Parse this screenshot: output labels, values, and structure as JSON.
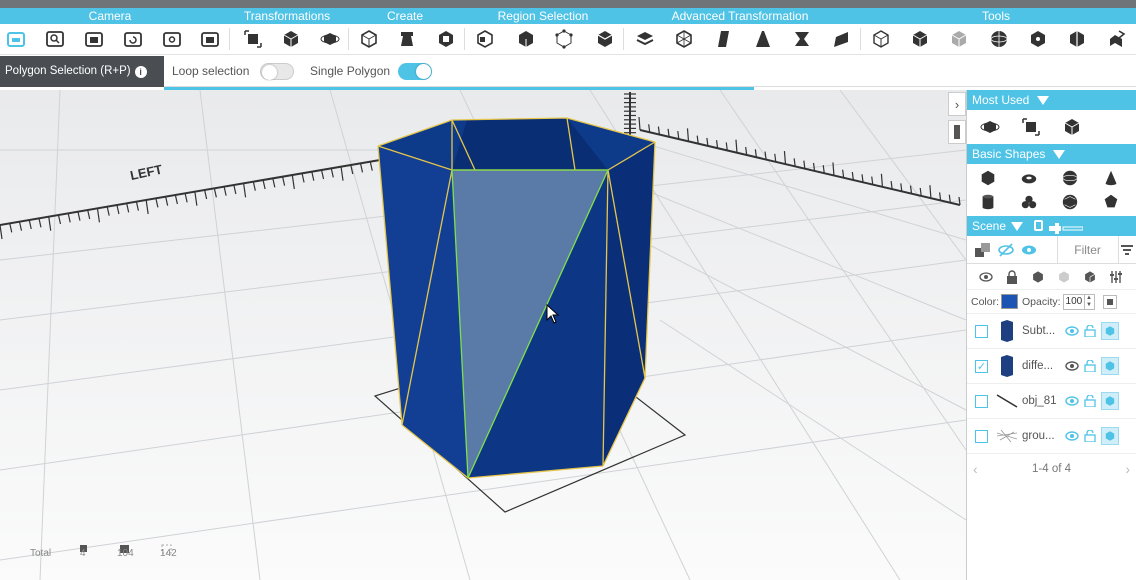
{
  "categories": [
    {
      "label": "Camera"
    },
    {
      "label": "Transformations"
    },
    {
      "label": "Create"
    },
    {
      "label": "Region Selection"
    },
    {
      "label": "Advanced Transformation"
    },
    {
      "label": "Tools"
    }
  ],
  "selection_bar": {
    "mode": "Polygon Selection (R+P)",
    "info": "i",
    "loop_label": "Loop selection",
    "loop_on": false,
    "single_label": "Single Polygon",
    "single_on": true
  },
  "viewport": {
    "axis_label": "LEFT",
    "stats": {
      "label": "Total",
      "objects": "4",
      "faces": "104",
      "vertices": "142"
    }
  },
  "panel": {
    "most_used": "Most Used",
    "basic_shapes": "Basic Shapes",
    "scene": "Scene",
    "filter_placeholder": "Filter",
    "color_label": "Color:",
    "opacity_label": "Opacity:",
    "opacity_value": "100",
    "color_value": "#1c54b4",
    "objects": [
      {
        "name": "Subt...",
        "checked": false
      },
      {
        "name": "diffe...",
        "checked": true
      },
      {
        "name": "obj_81",
        "checked": false
      },
      {
        "name": "grou...",
        "checked": false
      }
    ],
    "pager": "1-4 of 4"
  },
  "colors": {
    "accent": "#4ec3e6",
    "mesh": "#0e3a8a",
    "selected_face": "#5a7ba8",
    "edge": "#e6c64a"
  }
}
